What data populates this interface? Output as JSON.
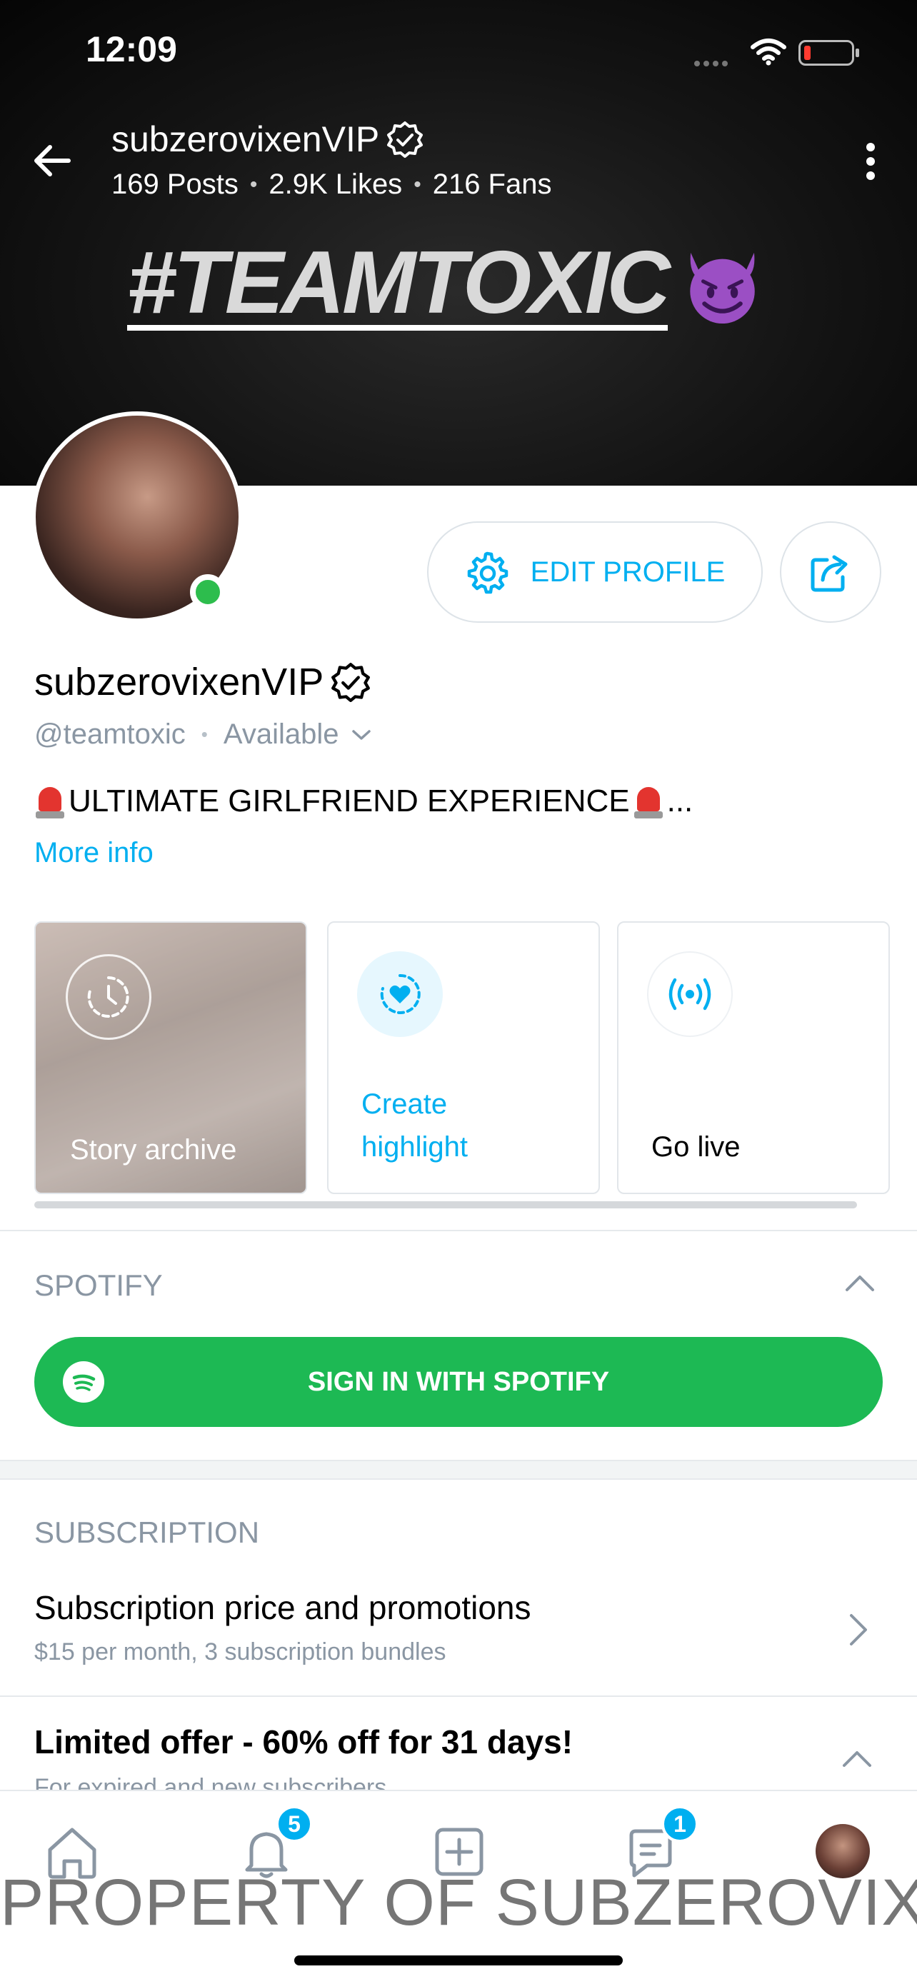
{
  "status_bar": {
    "time": "12:09"
  },
  "header": {
    "name": "subzerovixenVIP",
    "stats": {
      "posts": "169 Posts",
      "likes": "2.9K Likes",
      "fans": "216 Fans"
    },
    "banner_text": "#TEAMTOXIC"
  },
  "profile": {
    "name": "subzerovixenVIP",
    "handle": "@teamtoxic",
    "availability": "Available",
    "bio": "ULTIMATE GIRLFRIEND EXPERIENCE",
    "bio_ellipsis": "...",
    "more_info": "More info",
    "edit_profile_label": "EDIT PROFILE"
  },
  "stories": {
    "archive_label": "Story archive",
    "highlight_line1": "Create",
    "highlight_line2": "highlight",
    "live_label": "Go live"
  },
  "spotify": {
    "title": "SPOTIFY",
    "button_label": "SIGN IN WITH SPOTIFY"
  },
  "subscription": {
    "title": "SUBSCRIPTION",
    "price_title": "Subscription price and promotions",
    "price_subtitle": "$15 per month, 3 subscription bundles",
    "offer_title": "Limited offer - 60% off for 31 days!",
    "offer_subtitle": "For expired and new subscribers"
  },
  "bottom_nav": {
    "notifications_badge": "5",
    "messages_badge": "1"
  },
  "watermark": "PROPERTY OF SUBZEROVIXEN",
  "colors": {
    "accent": "#00aff0",
    "spotify": "#1db954",
    "online": "#2dbd4d"
  }
}
